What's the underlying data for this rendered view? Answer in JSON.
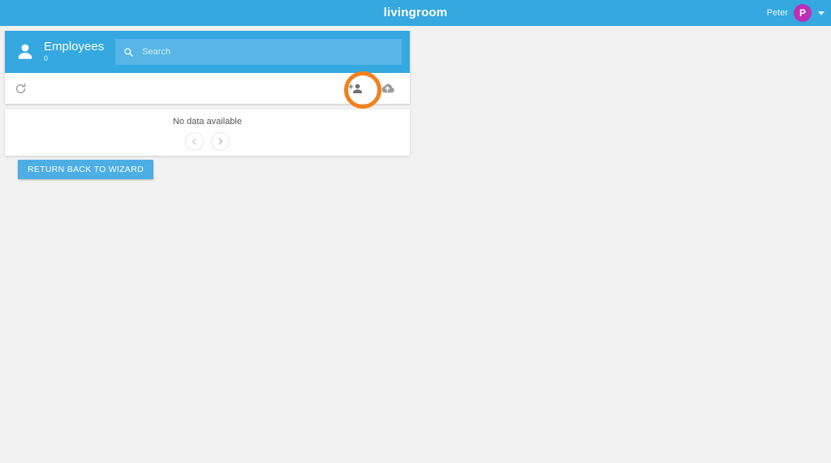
{
  "appbar": {
    "title": "livingroom",
    "user_name": "Peter",
    "avatar_initial": "P",
    "brand_color": "#35a8e0",
    "avatar_color": "#bd30b5",
    "dropdown_icon": "caret-down-icon"
  },
  "panel": {
    "icon": "person-icon",
    "title": "Employees",
    "count": "0",
    "search": {
      "placeholder": "Search",
      "value": "",
      "icon": "search-icon"
    },
    "toolbar": {
      "refresh": {
        "label": "Refresh",
        "icon": "refresh-icon"
      },
      "add_person": {
        "label": "Add employee",
        "icon": "person-add-icon"
      },
      "upload": {
        "label": "Upload",
        "icon": "cloud-upload-icon"
      }
    }
  },
  "data_area": {
    "empty_message": "No data available",
    "pagination": {
      "previous": {
        "label": "Previous",
        "icon": "chevron-left-icon"
      },
      "next": {
        "label": "Next",
        "icon": "chevron-right-icon"
      }
    }
  },
  "actions": {
    "return_wizard_label": "RETURN BACK TO WIZARD"
  },
  "annotation": {
    "target": "person-add-icon",
    "color": "#f2811d"
  }
}
